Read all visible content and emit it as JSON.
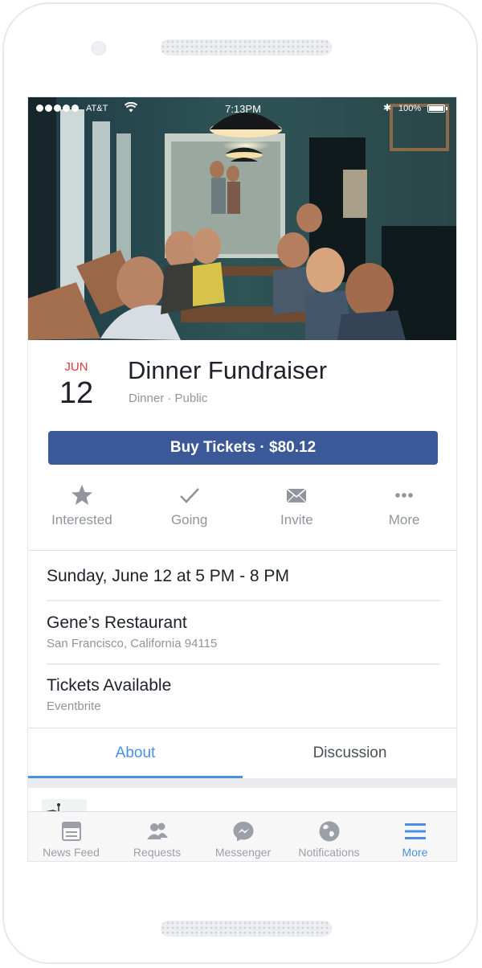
{
  "status_bar": {
    "carrier": "AT&T",
    "time": "7:13PM",
    "battery": "100%",
    "bluetooth_symbol": "✱"
  },
  "event": {
    "month": "JUN",
    "day": "12",
    "title": "Dinner Fundraiser",
    "meta": "Dinner · Public",
    "buy_button": "Buy Tickets · $80.12"
  },
  "actions": [
    {
      "label": "Interested",
      "icon": "star-icon"
    },
    {
      "label": "Going",
      "icon": "check-icon"
    },
    {
      "label": "Invite",
      "icon": "envelope-icon"
    },
    {
      "label": "More",
      "icon": "more-dots-icon"
    }
  ],
  "details": {
    "datetime": "Sunday, June 12 at 5 PM - 8 PM",
    "venue": "Gene’s Restaurant",
    "address": "San Francisco, California 94115",
    "tickets_title": "Tickets Available",
    "tickets_source": "Eventbrite"
  },
  "tabs": [
    {
      "label": "About",
      "active": true
    },
    {
      "label": "Discussion",
      "active": false
    }
  ],
  "bottom_nav": [
    {
      "label": "News Feed",
      "icon": "news-feed-icon"
    },
    {
      "label": "Requests",
      "icon": "requests-icon"
    },
    {
      "label": "Messenger",
      "icon": "messenger-icon"
    },
    {
      "label": "Notifications",
      "icon": "globe-icon"
    },
    {
      "label": "More",
      "icon": "menu-icon",
      "active": true
    }
  ],
  "colors": {
    "accent": "#4a90e2",
    "button": "#3b5998",
    "month": "#e0393e"
  }
}
